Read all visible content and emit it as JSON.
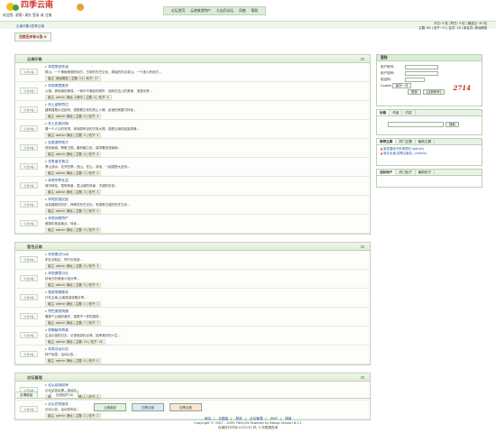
{
  "header": {
    "logo_text": "四季云南",
    "logo_url": "YNSJ.CN",
    "tagline": "欢迎您: 游客! 请先 登录 或 注册",
    "nav": [
      "论坛首页",
      "云南旅游特产",
      "九仙月论坛",
      "风格",
      "帮助"
    ]
  },
  "crumb": "云南印象1四季云南",
  "stats": {
    "line1": "今日: 0 帖 | 昨日: 0 帖 | 最高日: 40 帖",
    "line2": "主题: 63 | 帖子: 71 | 会员: 18 | 新会员: 静远微观"
  },
  "announcement": "当前还未有公告 0",
  "sections": [
    {
      "title": "云南印象",
      "forums": [
        {
          "name": "本地常说杂谈",
          "desc": "那山，一个神秘美丽的地方，古老的东巴文化，原始的东北茶山，一个迷人的地方...",
          "meta": "版主: 静远微观 | 主题: 13 | 帖子: 17"
        },
        {
          "name": "本地美食推荐",
          "desc": "火锅，具地道的美味，一家中不满足的城市，品味在这儿的美食，漫漫长夜...",
          "meta": "版主: admin 静远 小静可 | 主题: 4 | 帖子: 4"
        },
        {
          "name": "本土建筑特点",
          "desc": "建筑建是从这起来，感受着古老的风土人情，民宿的房屋与特色...",
          "meta": "版主: admin 静远 | 主题: 4 | 帖子: 4"
        },
        {
          "name": "本土民族风情",
          "desc": "看一个人心的安排，体味原来自的古老大理，感受云南的民族风情...",
          "meta": "版主: admin 静远 | 主题: 3 | 帖子: 3"
        },
        {
          "name": "去旅游的地方",
          "desc": "西双版纳，野象王国，最有趣之处，感觉着西双版纳...",
          "meta": "版主: admin 静远 | 主题: 4 | 帖子: 4"
        },
        {
          "name": "名胜著名景点",
          "desc": "青山流水，花开四季，西山、苍山、滇池，一起感受大自然...",
          "meta": "版主: admin 静远 | 主题: 2 | 帖子: 2"
        },
        {
          "name": "本地中转社会",
          "desc": "城中转站，昆明风景，昆山城的风景，古城的传说...",
          "meta": "版主: admin 静远 | 主题: 3 | 帖子: 3"
        },
        {
          "name": "本地民俗民居",
          "desc": "谈谈建筑的历史，神奇的东巴文化，来感受古城的历史文化...",
          "meta": "版主: admin 静远 | 主题: 2 | 帖子: 2"
        },
        {
          "name": "本地风物特产",
          "desc": "美丽的旅游景点，特色...",
          "meta": "版主: admin 静远 | 主题: 0 | 帖子: 0"
        }
      ]
    },
    {
      "title": "客色云南",
      "forums": [
        {
          "name": "本地景点行动",
          "desc": "驴友互助区，同行去旅游...",
          "meta": "版主: admin 静远 | 主题: 3 | 帖子: 3"
        },
        {
          "name": "本地美食讨论",
          "desc": "好地方的美食介绍分享...",
          "meta": "版主: admin 静远 | 主题: 5 | 帖子: 5"
        },
        {
          "name": "旅游攻略推荐",
          "desc": "行在云南,云南旅游攻略分享...",
          "meta": "版主: admin 静远 | 主题: 1 | 帖子: 1"
        },
        {
          "name": "特色旅游线路",
          "desc": "看那个云南的美好，感受不一样的感觉...",
          "meta": "版主: admin 静远 | 主题: 7 | 帖子: 7"
        },
        {
          "name": "攻略精华转载",
          "desc": "生活记录的日志，记录旅游的点滴，独享美好的人生...",
          "meta": "版主: admin 静远 | 主题: 14 | 帖子: 14"
        },
        {
          "name": "本地活动公告",
          "desc": "特产信息，活动公告...",
          "meta": "版主: admin 静远 | 主题: 0 | 帖子: 0"
        }
      ]
    },
    {
      "title": "论坛管理",
      "forums": [
        {
          "name": "论坛现场简单",
          "desc": "论坛站务处理，申诉区...",
          "meta": "版主: admin 静远 | 主题: 1 | 帖子: 1"
        },
        {
          "name": "论坛综合服务",
          "desc": "论坛公告，活动发布区...",
          "meta": "版主: admin 静远 | 主题: 2 | 帖子: 2"
        }
      ]
    }
  ],
  "forum_icon_label": "今日0帖",
  "sidebar": {
    "login_title": "登陆",
    "user_label": "用户帐号:",
    "pass_label": "用户密码:",
    "code_label": "验证码:",
    "code_value": "2714",
    "cookie_label": "Cookie",
    "cookie_value": "保存一月",
    "login_button": "登录",
    "register_button": "[注册帐号]",
    "tabs": [
      "标题",
      "作者",
      "内容"
    ],
    "search_button": "搜索",
    "tabs2": [
      "推荐主题",
      "热门主题",
      "最新主题"
    ],
    "recommended": [
      "新发展帖子申请须知 (admin)",
      "新手必读-四季云南论...(admin)"
    ],
    "tabs3": [
      "活跃用户",
      "热门帖子",
      "最新帖子"
    ]
  },
  "bottom_tabs": [
    "友情链接",
    "在线用户(0)"
  ],
  "badges": [
    "云南旅游",
    "四季云南",
    "四季云南"
  ],
  "footer": {
    "links": [
      "网站",
      "无图版",
      "联系",
      "论坛管理",
      "WAP",
      "搜索"
    ],
    "copyright": "Copyright © 2007 - 2009 YNSJ.CN Powered by Bbsxp Version 8.1.1",
    "runtime": "页面执行时间 0.03125 秒, 0 次数据查询"
  }
}
